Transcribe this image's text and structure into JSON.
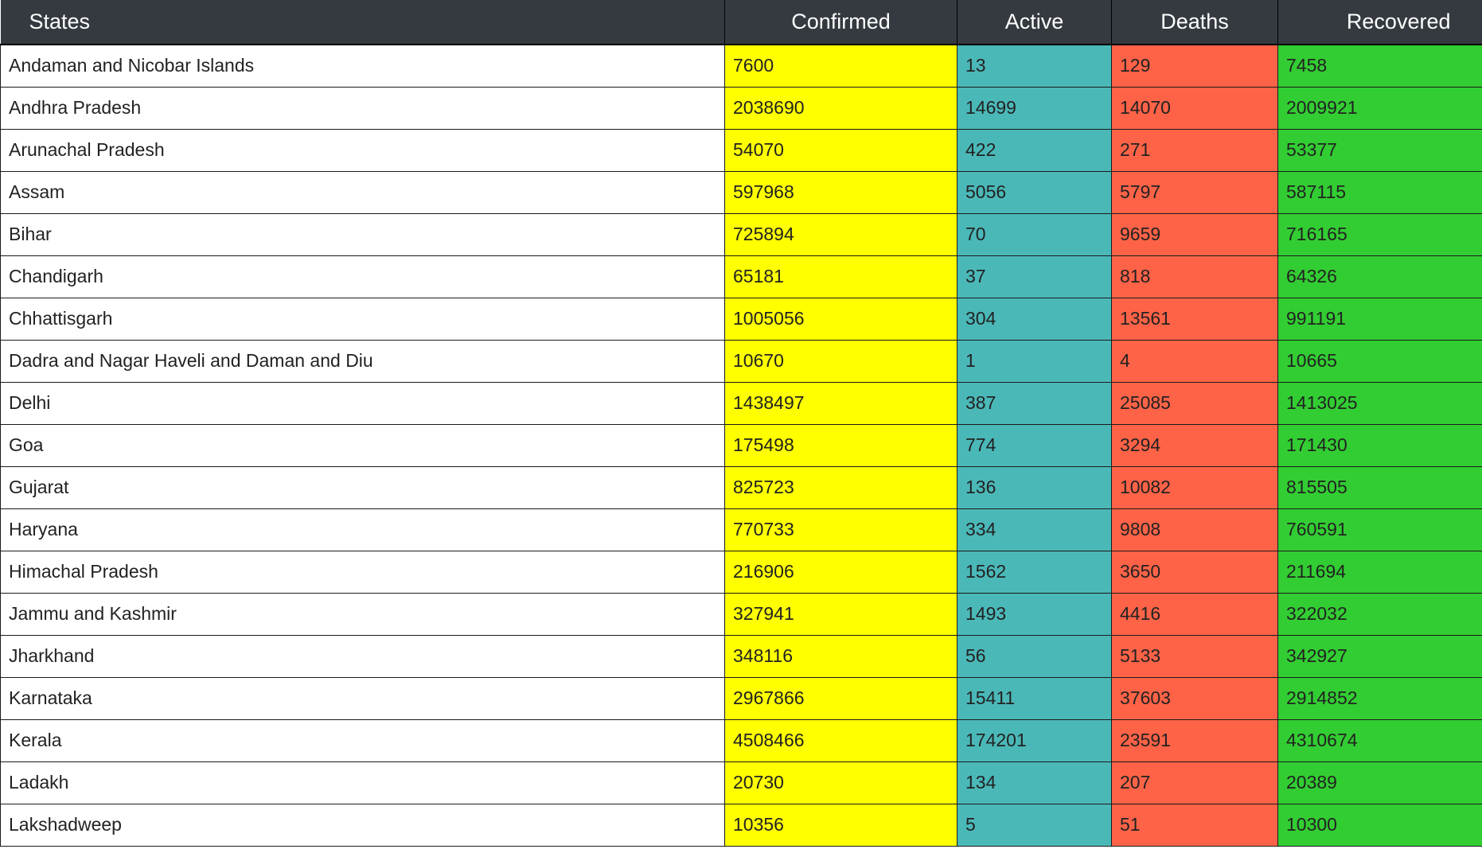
{
  "columns": {
    "state": "States",
    "confirmed": "Confirmed",
    "active": "Active",
    "deaths": "Deaths",
    "recovered": "Recovered"
  },
  "colors": {
    "header_bg": "#343a40",
    "confirmed": "#ffff00",
    "active": "#4bb8b8",
    "deaths": "#ff6347",
    "recovered": "#32cd32"
  },
  "rows": [
    {
      "state": "Andaman and Nicobar Islands",
      "confirmed": "7600",
      "active": "13",
      "deaths": "129",
      "recovered": "7458"
    },
    {
      "state": "Andhra Pradesh",
      "confirmed": "2038690",
      "active": "14699",
      "deaths": "14070",
      "recovered": "2009921"
    },
    {
      "state": "Arunachal Pradesh",
      "confirmed": "54070",
      "active": "422",
      "deaths": "271",
      "recovered": "53377"
    },
    {
      "state": "Assam",
      "confirmed": "597968",
      "active": "5056",
      "deaths": "5797",
      "recovered": "587115"
    },
    {
      "state": "Bihar",
      "confirmed": "725894",
      "active": "70",
      "deaths": "9659",
      "recovered": "716165"
    },
    {
      "state": "Chandigarh",
      "confirmed": "65181",
      "active": "37",
      "deaths": "818",
      "recovered": "64326"
    },
    {
      "state": "Chhattisgarh",
      "confirmed": "1005056",
      "active": "304",
      "deaths": "13561",
      "recovered": "991191"
    },
    {
      "state": "Dadra and Nagar Haveli and Daman and Diu",
      "confirmed": "10670",
      "active": "1",
      "deaths": "4",
      "recovered": "10665"
    },
    {
      "state": "Delhi",
      "confirmed": "1438497",
      "active": "387",
      "deaths": "25085",
      "recovered": "1413025"
    },
    {
      "state": "Goa",
      "confirmed": "175498",
      "active": "774",
      "deaths": "3294",
      "recovered": "171430"
    },
    {
      "state": "Gujarat",
      "confirmed": "825723",
      "active": "136",
      "deaths": "10082",
      "recovered": "815505"
    },
    {
      "state": "Haryana",
      "confirmed": "770733",
      "active": "334",
      "deaths": "9808",
      "recovered": "760591"
    },
    {
      "state": "Himachal Pradesh",
      "confirmed": "216906",
      "active": "1562",
      "deaths": "3650",
      "recovered": "211694"
    },
    {
      "state": "Jammu and Kashmir",
      "confirmed": "327941",
      "active": "1493",
      "deaths": "4416",
      "recovered": "322032"
    },
    {
      "state": "Jharkhand",
      "confirmed": "348116",
      "active": "56",
      "deaths": "5133",
      "recovered": "342927"
    },
    {
      "state": "Karnataka",
      "confirmed": "2967866",
      "active": "15411",
      "deaths": "37603",
      "recovered": "2914852"
    },
    {
      "state": "Kerala",
      "confirmed": "4508466",
      "active": "174201",
      "deaths": "23591",
      "recovered": "4310674"
    },
    {
      "state": "Ladakh",
      "confirmed": "20730",
      "active": "134",
      "deaths": "207",
      "recovered": "20389"
    },
    {
      "state": "Lakshadweep",
      "confirmed": "10356",
      "active": "5",
      "deaths": "51",
      "recovered": "10300"
    }
  ]
}
